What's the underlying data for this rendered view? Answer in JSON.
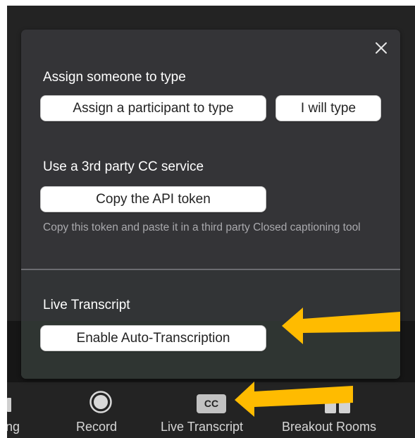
{
  "popup": {
    "close_icon": "close-icon",
    "assign_section": {
      "title": "Assign someone to type",
      "assign_participant_button": "Assign a participant to type",
      "self_type_button": "I will type"
    },
    "third_party_section": {
      "title": "Use a 3rd party CC service",
      "copy_token_button": "Copy the API token",
      "hint": "Copy this token and paste it in a third party Closed captioning tool"
    },
    "live_transcript_section": {
      "title": "Live Transcript",
      "enable_button": "Enable Auto-Transcription"
    }
  },
  "toolbar": {
    "items": [
      {
        "label": "ng",
        "icon": "partial-icon"
      },
      {
        "label": "Record",
        "icon": "record-icon"
      },
      {
        "label": "Live Transcript",
        "icon": "cc-icon",
        "icon_text": "CC"
      },
      {
        "label": "Breakout Rooms",
        "icon": "breakout-rooms-icon"
      }
    ]
  },
  "annotations": {
    "arrow_color": "#ffbb00"
  },
  "colors": {
    "popup_bg": "#343437",
    "toolbar_bg": "#232323",
    "button_bg": "#ffffff",
    "hint_text": "#a9a9ad"
  }
}
